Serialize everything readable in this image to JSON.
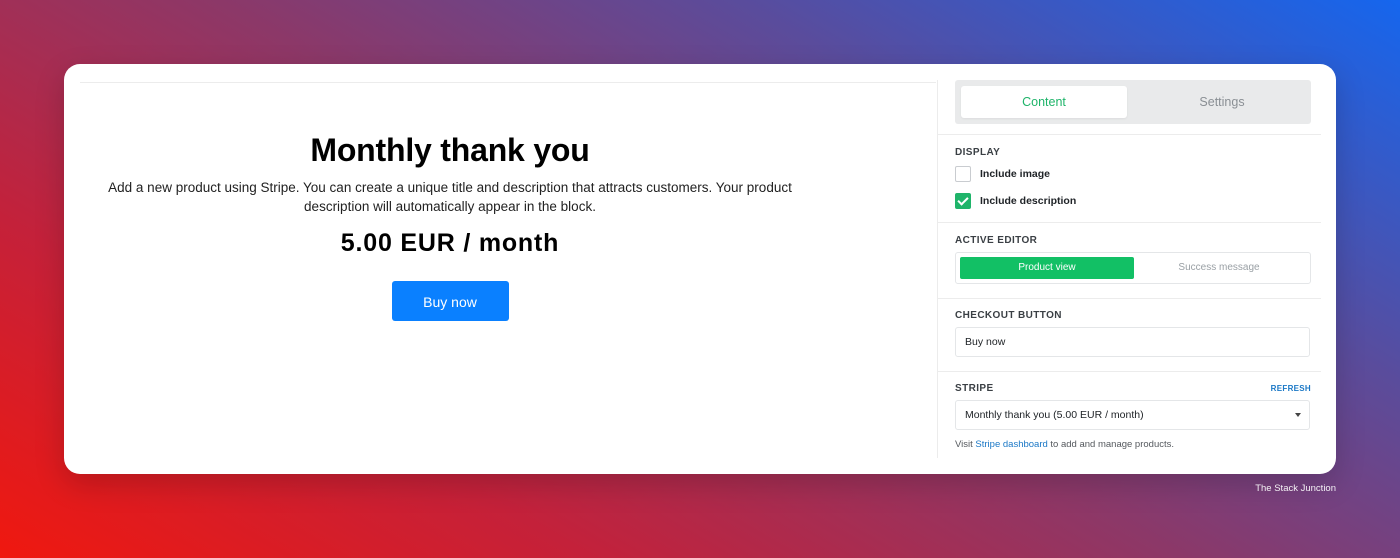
{
  "preview": {
    "title": "Monthly thank you",
    "description": "Add a new product using Stripe. You can create a unique title and description that attracts customers. Your product description will automatically appear in the block.",
    "price": "5.00 EUR / month",
    "buy_button": "Buy now"
  },
  "sidebar": {
    "tabs": [
      {
        "label": "Content",
        "active": true
      },
      {
        "label": "Settings",
        "active": false
      }
    ],
    "display": {
      "label": "DISPLAY",
      "include_image": {
        "label": "Include image",
        "checked": false
      },
      "include_description": {
        "label": "Include description",
        "checked": true
      }
    },
    "active_editor": {
      "label": "ACTIVE EDITOR",
      "options": [
        {
          "label": "Product view",
          "active": true
        },
        {
          "label": "Success message",
          "active": false
        }
      ]
    },
    "checkout_button": {
      "label": "CHECKOUT BUTTON",
      "value": "Buy now"
    },
    "stripe": {
      "label": "STRIPE",
      "refresh": "REFRESH",
      "selected_product": "Monthly thank you (5.00 EUR / month)",
      "help_prefix": "Visit",
      "help_link": "Stripe dashboard",
      "help_suffix": "to add and manage products."
    }
  },
  "watermark": "The Stack Junction",
  "colors": {
    "accent_green": "#12c065",
    "buy_blue": "#0a80ff",
    "link_blue": "#1b78c6"
  }
}
